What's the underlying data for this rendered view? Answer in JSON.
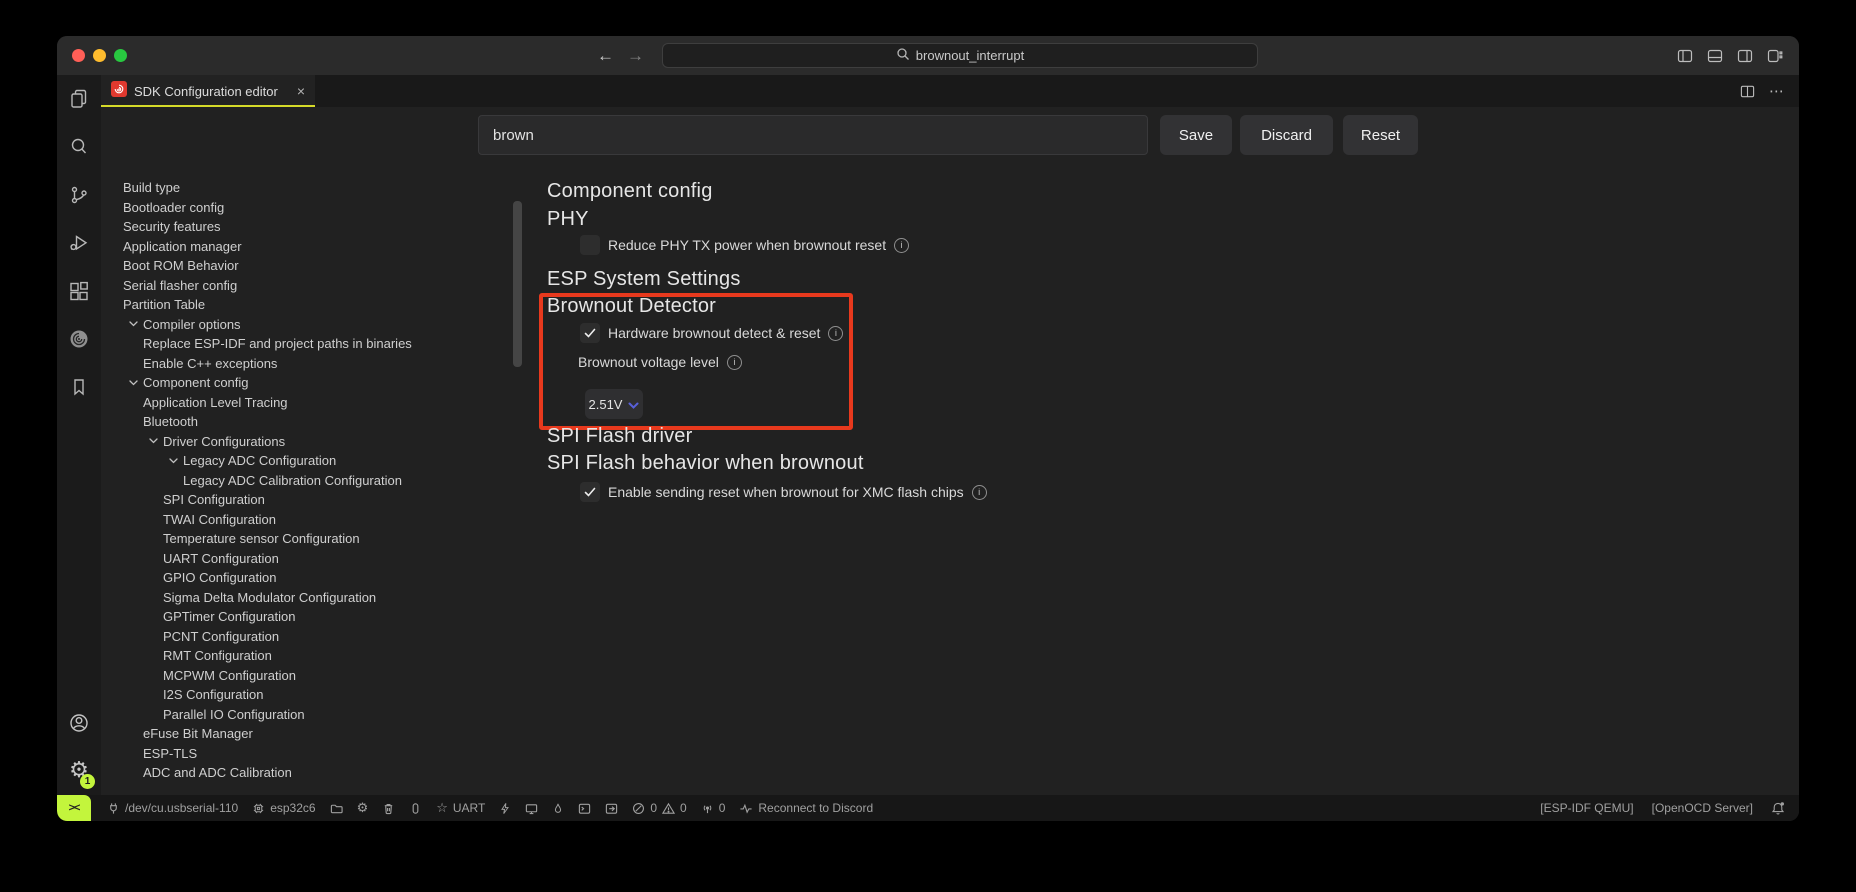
{
  "colors": {
    "accent_red": "#e8391d",
    "lime": "#c3f53c",
    "tab_underline": "#d5da29"
  },
  "glyphs": {
    "back": "←",
    "forward": "→",
    "close": "×",
    "ellipsis": "⋯",
    "gear": "⚙",
    "star": "☆",
    "info": "i",
    "remote": "><"
  },
  "titlebar": {
    "search_value": "brownout_interrupt"
  },
  "tab": {
    "label": "SDK Configuration editor"
  },
  "toolbar": {
    "search_value": "brown",
    "save": "Save",
    "discard": "Discard",
    "reset": "Reset"
  },
  "tree": {
    "items": [
      {
        "label": "Build type",
        "depth": 0,
        "chevron": false
      },
      {
        "label": "Bootloader config",
        "depth": 0,
        "chevron": false
      },
      {
        "label": "Security features",
        "depth": 0,
        "chevron": false
      },
      {
        "label": "Application manager",
        "depth": 0,
        "chevron": false
      },
      {
        "label": "Boot ROM Behavior",
        "depth": 0,
        "chevron": false
      },
      {
        "label": "Serial flasher config",
        "depth": 0,
        "chevron": false
      },
      {
        "label": "Partition Table",
        "depth": 0,
        "chevron": false
      },
      {
        "label": "Compiler options",
        "depth": 0,
        "chevron": true
      },
      {
        "label": "Replace ESP-IDF and project paths in binaries",
        "depth": 1,
        "chevron": false
      },
      {
        "label": "Enable C++ exceptions",
        "depth": 1,
        "chevron": false
      },
      {
        "label": "Component config",
        "depth": 0,
        "chevron": true
      },
      {
        "label": "Application Level Tracing",
        "depth": 1,
        "chevron": false
      },
      {
        "label": "Bluetooth",
        "depth": 1,
        "chevron": false
      },
      {
        "label": "Driver Configurations",
        "depth": 1,
        "chevron": true
      },
      {
        "label": "Legacy ADC Configuration",
        "depth": 2,
        "chevron": true
      },
      {
        "label": "Legacy ADC Calibration Configuration",
        "depth": 3,
        "chevron": false
      },
      {
        "label": "SPI Configuration",
        "depth": 2,
        "chevron": false
      },
      {
        "label": "TWAI Configuration",
        "depth": 2,
        "chevron": false
      },
      {
        "label": "Temperature sensor Configuration",
        "depth": 2,
        "chevron": false
      },
      {
        "label": "UART Configuration",
        "depth": 2,
        "chevron": false
      },
      {
        "label": "GPIO Configuration",
        "depth": 2,
        "chevron": false
      },
      {
        "label": "Sigma Delta Modulator Configuration",
        "depth": 2,
        "chevron": false
      },
      {
        "label": "GPTimer Configuration",
        "depth": 2,
        "chevron": false
      },
      {
        "label": "PCNT Configuration",
        "depth": 2,
        "chevron": false
      },
      {
        "label": "RMT Configuration",
        "depth": 2,
        "chevron": false
      },
      {
        "label": "MCPWM Configuration",
        "depth": 2,
        "chevron": false
      },
      {
        "label": "I2S Configuration",
        "depth": 2,
        "chevron": false
      },
      {
        "label": "Parallel IO Configuration",
        "depth": 2,
        "chevron": false
      },
      {
        "label": "eFuse Bit Manager",
        "depth": 1,
        "chevron": false
      },
      {
        "label": "ESP-TLS",
        "depth": 1,
        "chevron": false
      },
      {
        "label": "ADC and ADC Calibration",
        "depth": 1,
        "chevron": false
      }
    ]
  },
  "content": {
    "heading_component_config": "Component config",
    "heading_phy": "PHY",
    "row_phy_tx": {
      "label": "Reduce PHY TX power when brownout reset",
      "checked": false
    },
    "heading_esp_system": "ESP System Settings",
    "heading_brownout": "Brownout Detector",
    "row_hw_brownout": {
      "label": "Hardware brownout detect & reset",
      "checked": true
    },
    "label_voltage": "Brownout voltage level",
    "dropdown_value": "2.51V",
    "heading_spi_driver": "SPI Flash driver",
    "heading_spi_behavior": "SPI Flash behavior when brownout",
    "row_xmc": {
      "label": "Enable sending reset when brownout for XMC flash chips",
      "checked": true
    }
  },
  "statusbar": {
    "port": "/dev/cu.usbserial-110",
    "device_target": "esp32c6",
    "uart": "UART",
    "errors": "0",
    "warnings": "0",
    "ports_count": "0",
    "discord": "Reconnect to Discord",
    "qemu": "[ESP-IDF QEMU]",
    "openocd": "[OpenOCD Server]"
  },
  "activity_badge": "1"
}
